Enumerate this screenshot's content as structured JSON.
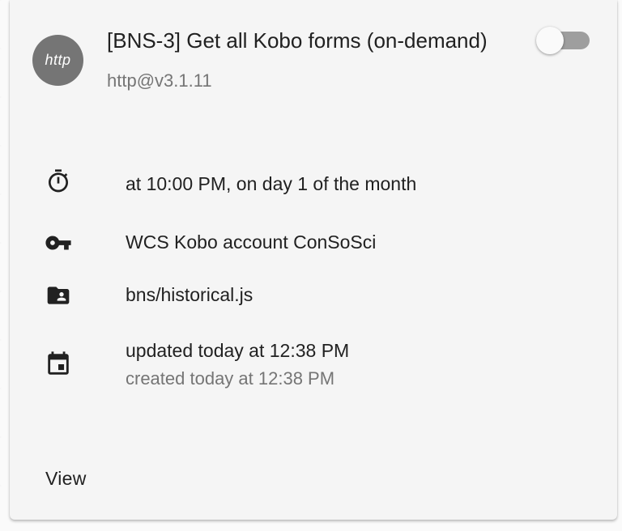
{
  "card": {
    "avatar_text": "http",
    "title": "[BNS-3] Get all Kobo forms (on-demand)",
    "subtitle": "http@v3.1.11",
    "toggle_enabled": false
  },
  "details": {
    "schedule": "at 10:00 PM, on day 1 of the month",
    "credential": "WCS Kobo account ConSoSci",
    "job_path": "bns/historical.js",
    "updated": "updated today at 12:38 PM",
    "created": "created today at 12:38 PM"
  },
  "actions": {
    "view_label": "View"
  },
  "icons": {
    "schedule": "timer-icon",
    "credential": "key-icon",
    "job_path": "folder-shared-icon",
    "dates": "calendar-icon"
  },
  "colors": {
    "card_bg": "#f5f5f5",
    "avatar_bg": "#757575",
    "primary_text": "#212121",
    "secondary_text": "#757575",
    "toggle_track": "#9e9e9e"
  }
}
